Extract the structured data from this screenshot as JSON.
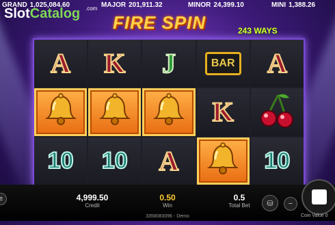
{
  "jackpots": [
    {
      "label": "GRAND",
      "value": "1,025,084.60"
    },
    {
      "label": "MAJOR",
      "value": "201,911.32"
    },
    {
      "label": "MINOR",
      "value": "24,399.10"
    },
    {
      "label": "MINI",
      "value": "1,388.26"
    }
  ],
  "watermark": {
    "slot": "Slot",
    "catalog": "Catalog",
    "com": ".com"
  },
  "game": {
    "title": "FIRE SPIN",
    "ways": "243 WAYS"
  },
  "reels": [
    [
      "A",
      "K",
      "J",
      "BAR",
      "A"
    ],
    [
      "BELL",
      "BELL",
      "BELL",
      "K",
      "CHERRY"
    ],
    [
      "10",
      "10",
      "A",
      "BELL",
      "10"
    ]
  ],
  "winning_cells": [
    [
      1,
      0
    ],
    [
      1,
      1
    ],
    [
      1,
      2
    ],
    [
      2,
      3
    ]
  ],
  "stats": {
    "credit": {
      "value": "4,999.50",
      "label": "Credit"
    },
    "win": {
      "value": "0.50",
      "label": "Win"
    },
    "total_bet": {
      "value": "0.5",
      "label": "Total Bet"
    }
  },
  "round_id": "3358083096 - Demo",
  "coin_value_label": "Coin Value 0",
  "colors": {
    "win_value": "#ffcc33",
    "accent": "#7a48d8"
  }
}
